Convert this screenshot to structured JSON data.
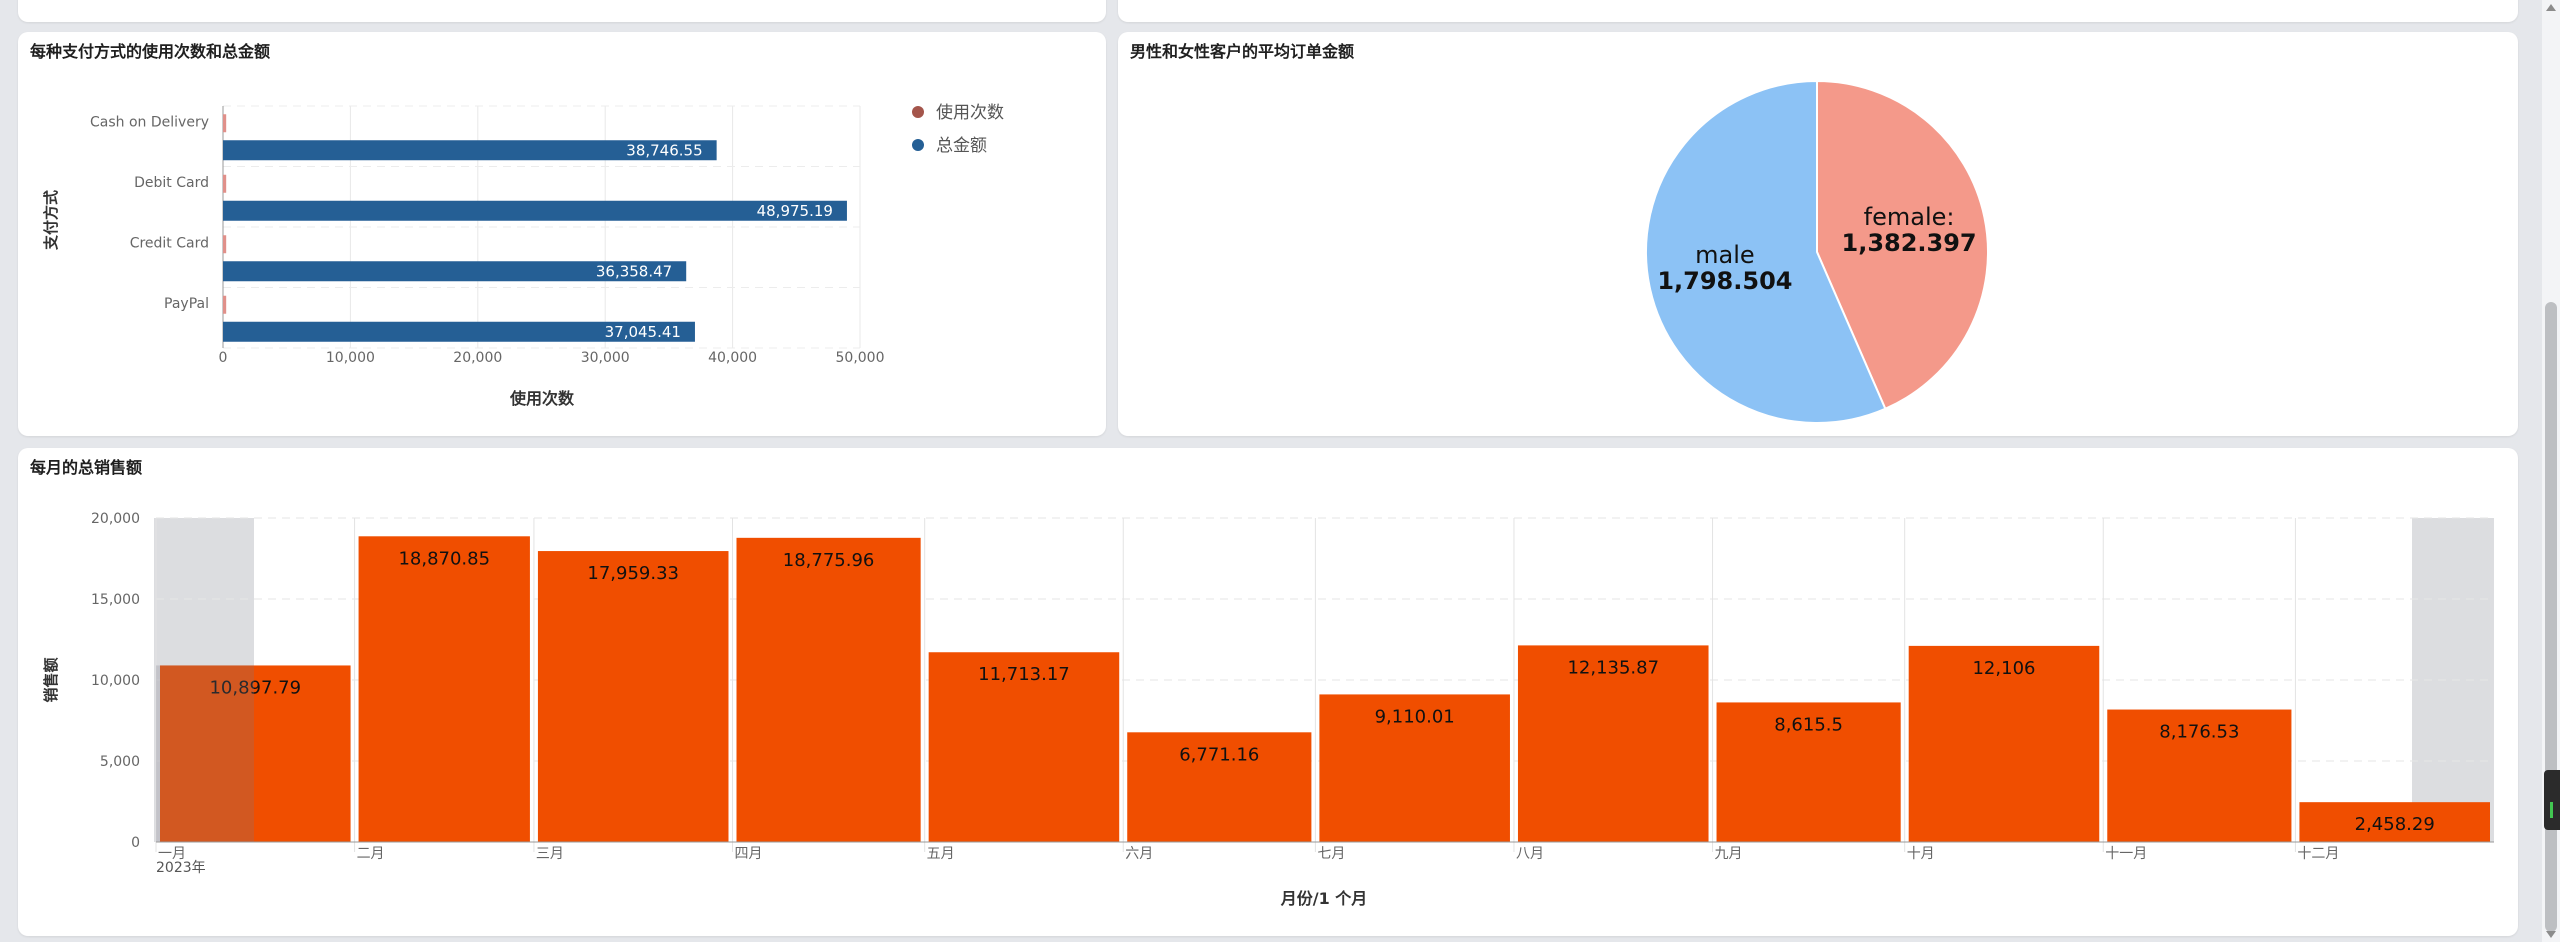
{
  "payment_panel": {
    "title": "每种支付方式的使用次数和总金额",
    "y_axis_label": "支付方式",
    "x_axis_label": "使用次数",
    "legend": [
      {
        "label": "使用次数",
        "color": "#a4554b"
      },
      {
        "label": "总金额",
        "color": "#255f95"
      }
    ]
  },
  "gender_panel": {
    "title": "男性和女性客户的平均订单金额"
  },
  "sales_panel": {
    "title": "每月的总销售额",
    "y_axis_label": "销售额",
    "x_axis_label": "月份/1 个月",
    "year_label": "2023年"
  },
  "chart_data": [
    {
      "type": "bar",
      "orientation": "horizontal",
      "title": "每种支付方式的使用次数和总金额",
      "ylabel": "支付方式",
      "xlabel": "使用次数",
      "categories": [
        "Cash on Delivery",
        "Debit Card",
        "Credit Card",
        "PayPal"
      ],
      "series": [
        {
          "name": "使用次数",
          "values": [
            250,
            250,
            250,
            250
          ],
          "color": "#e0908a"
        },
        {
          "name": "总金额",
          "values": [
            38746.55,
            48975.19,
            36358.47,
            37045.41
          ],
          "labels": [
            "38,746.55",
            "48,975.19",
            "36,358.47",
            "37,045.41"
          ],
          "color": "#255f95"
        }
      ],
      "xlim": [
        0,
        50000
      ],
      "x_ticks": [
        "0",
        "10,000",
        "20,000",
        "30,000",
        "40,000",
        "50,000"
      ],
      "legend_position": "right",
      "grid": true
    },
    {
      "type": "pie",
      "title": "男性和女性客户的平均订单金额",
      "slices": [
        {
          "name": "female",
          "label": "female:",
          "value": 1382.397,
          "value_label": "1,382.397",
          "color": "#f4998a"
        },
        {
          "name": "male",
          "label": "male",
          "value": 1798.504,
          "value_label": "1,798.504",
          "color": "#8cc2f5"
        }
      ]
    },
    {
      "type": "bar",
      "title": "每月的总销售额",
      "ylabel": "销售额",
      "xlabel": "月份/1 个月",
      "categories": [
        "一月",
        "二月",
        "三月",
        "四月",
        "五月",
        "六月",
        "七月",
        "八月",
        "九月",
        "十月",
        "十一月",
        "十二月"
      ],
      "values": [
        10897.79,
        18870.85,
        17959.33,
        18775.96,
        11713.17,
        6771.16,
        9110.01,
        12135.87,
        8615.5,
        12106,
        8176.53,
        2458.29
      ],
      "labels": [
        "10,897.79",
        "18,870.85",
        "17,959.33",
        "18,775.96",
        "11,713.17",
        "6,771.16",
        "9,110.01",
        "12,135.87",
        "8,615.5",
        "12,106",
        "8,176.53",
        "2,458.29"
      ],
      "ylim": [
        0,
        20000
      ],
      "y_ticks": [
        "0",
        "5,000",
        "10,000",
        "15,000",
        "20,000"
      ],
      "color": "#f04e00",
      "grid": true
    }
  ]
}
